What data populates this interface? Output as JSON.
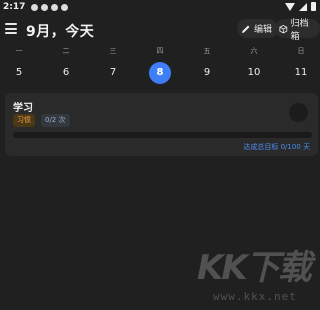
{
  "status_bar": {
    "time": "2:17"
  },
  "app_bar": {
    "title": "9月，今天",
    "edit_label": "编辑",
    "archive_label": "归档箱"
  },
  "week": {
    "weekdays": [
      "一",
      "二",
      "三",
      "四",
      "五",
      "六",
      "日"
    ],
    "days": [
      "5",
      "6",
      "7",
      "8",
      "9",
      "10",
      "11"
    ],
    "selected_day": "8"
  },
  "habit_card": {
    "title": "学习",
    "tag_habit": "习惯",
    "tag_count": "0/2 次",
    "progress_fraction": 0,
    "goal_text": "达成总目标 0/100 天"
  },
  "watermark": {
    "logo": "KK下载",
    "url": "www.kkx.net"
  },
  "colors": {
    "accent": "#3e7ef7",
    "background": "#202020",
    "card": "#2a2a2a",
    "tag_orange": "#f0a040"
  }
}
